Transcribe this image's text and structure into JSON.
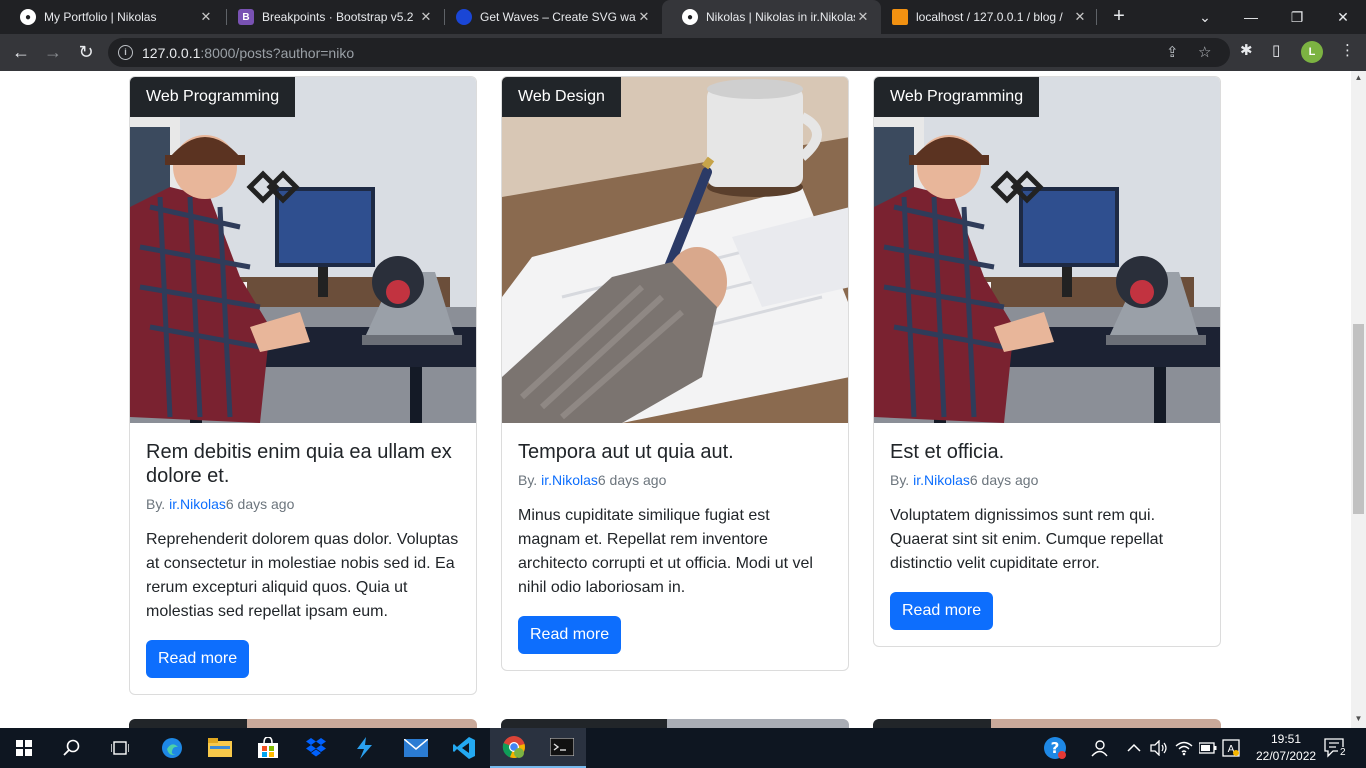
{
  "browser": {
    "tabs": [
      {
        "title": "My Portfolio | Nikolas",
        "favicon": "globe-icon",
        "active": false
      },
      {
        "title": "Breakpoints · Bootstrap v5.2",
        "favicon": "bootstrap-icon",
        "active": false
      },
      {
        "title": "Get Waves – Create SVG waves",
        "favicon": "waves-icon",
        "active": false
      },
      {
        "title": "Nikolas | Nikolas in ir.Nikolas",
        "favicon": "globe-icon",
        "active": true
      },
      {
        "title": "localhost / 127.0.0.1 / blog / ",
        "favicon": "phpmyadmin-icon",
        "active": false
      }
    ],
    "url_host": "127.0.0.1",
    "url_path": ":8000/posts?author=niko",
    "profile_initial": "L"
  },
  "posts": [
    {
      "category": "Web Programming",
      "title": "Rem debitis enim quia ea ullam ex dolore et.",
      "by": "By. ",
      "author": "ir.Nikolas",
      "time": "6 days ago",
      "excerpt": "Reprehenderit dolorem quas dolor. Voluptas at consectetur in molestiae nobis sed id. Ea rerum excepturi aliquid quos. Quia ut molestias sed repellat ipsam eum.",
      "button": "Read more"
    },
    {
      "category": "Web Design",
      "title": "Tempora aut ut quia aut.",
      "by": "By. ",
      "author": "ir.Nikolas",
      "time": "6 days ago",
      "excerpt": "Minus cupiditate similique fugiat est magnam et. Repellat rem inventore architecto corrupti et ut officia. Modi ut vel nihil odio laboriosam in.",
      "button": "Read more"
    },
    {
      "category": "Web Programming",
      "title": "Est et officia.",
      "by": "By. ",
      "author": "ir.Nikolas",
      "time": "6 days ago",
      "excerpt": "Voluptatem dignissimos sunt rem qui. Quaerat sint sit enim. Cumque repellat distinctio velit cupiditate error.",
      "button": "Read more"
    }
  ],
  "taskbar": {
    "time": "19:51",
    "date": "22/07/2022",
    "notification_count": "2"
  },
  "colors": {
    "primary": "#0d6efd",
    "badge": "#212529",
    "chrome_dark": "#202124"
  }
}
